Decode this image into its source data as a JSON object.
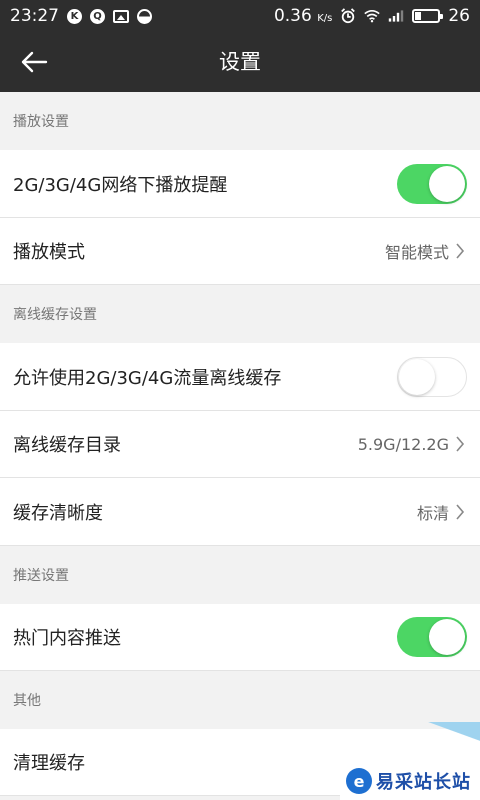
{
  "status_bar": {
    "time": "23:27",
    "left_icons": [
      "k-app-icon",
      "q-app-icon",
      "image-icon",
      "half-circle-icon"
    ],
    "speed_value": "0.36",
    "speed_unit": "K/s",
    "right_icons": [
      "alarm-icon",
      "wifi-icon",
      "signal-icon",
      "battery-icon"
    ],
    "battery_level": "26",
    "battery_fraction": 0.26
  },
  "nav": {
    "title": "设置",
    "back_icon": "back-arrow-icon"
  },
  "sections": {
    "playback": {
      "header": "播放设置",
      "network_reminder_label": "2G/3G/4G网络下播放提醒",
      "network_reminder_on": true,
      "mode_label": "播放模式",
      "mode_value": "智能模式"
    },
    "offline": {
      "header": "离线缓存设置",
      "allow_mobile_label": "允许使用2G/3G/4G流量离线缓存",
      "allow_mobile_on": false,
      "dir_label": "离线缓存目录",
      "dir_value": "5.9G/12.2G",
      "quality_label": "缓存清晰度",
      "quality_value": "标清"
    },
    "push": {
      "header": "推送设置",
      "hot_push_label": "热门内容推送",
      "hot_push_on": true
    },
    "other": {
      "header": "其他",
      "clear_cache_label": "清理缓存"
    }
  },
  "watermark": {
    "text": "易采站长站",
    "logo_letter": "e"
  },
  "colors": {
    "bar": "#2e2e2e",
    "toggle_on": "#4cd664",
    "background": "#f2f2f2"
  }
}
